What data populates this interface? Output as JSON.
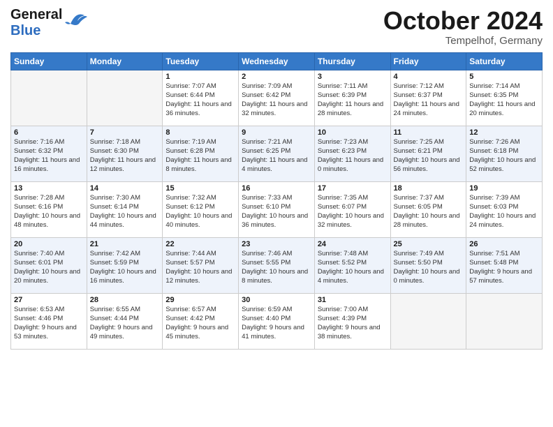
{
  "header": {
    "logo_general": "General",
    "logo_blue": "Blue",
    "title": "October 2024",
    "location": "Tempelhof, Germany"
  },
  "days_of_week": [
    "Sunday",
    "Monday",
    "Tuesday",
    "Wednesday",
    "Thursday",
    "Friday",
    "Saturday"
  ],
  "weeks": [
    [
      {
        "num": "",
        "info": ""
      },
      {
        "num": "",
        "info": ""
      },
      {
        "num": "1",
        "info": "Sunrise: 7:07 AM\nSunset: 6:44 PM\nDaylight: 11 hours and 36 minutes."
      },
      {
        "num": "2",
        "info": "Sunrise: 7:09 AM\nSunset: 6:42 PM\nDaylight: 11 hours and 32 minutes."
      },
      {
        "num": "3",
        "info": "Sunrise: 7:11 AM\nSunset: 6:39 PM\nDaylight: 11 hours and 28 minutes."
      },
      {
        "num": "4",
        "info": "Sunrise: 7:12 AM\nSunset: 6:37 PM\nDaylight: 11 hours and 24 minutes."
      },
      {
        "num": "5",
        "info": "Sunrise: 7:14 AM\nSunset: 6:35 PM\nDaylight: 11 hours and 20 minutes."
      }
    ],
    [
      {
        "num": "6",
        "info": "Sunrise: 7:16 AM\nSunset: 6:32 PM\nDaylight: 11 hours and 16 minutes."
      },
      {
        "num": "7",
        "info": "Sunrise: 7:18 AM\nSunset: 6:30 PM\nDaylight: 11 hours and 12 minutes."
      },
      {
        "num": "8",
        "info": "Sunrise: 7:19 AM\nSunset: 6:28 PM\nDaylight: 11 hours and 8 minutes."
      },
      {
        "num": "9",
        "info": "Sunrise: 7:21 AM\nSunset: 6:25 PM\nDaylight: 11 hours and 4 minutes."
      },
      {
        "num": "10",
        "info": "Sunrise: 7:23 AM\nSunset: 6:23 PM\nDaylight: 11 hours and 0 minutes."
      },
      {
        "num": "11",
        "info": "Sunrise: 7:25 AM\nSunset: 6:21 PM\nDaylight: 10 hours and 56 minutes."
      },
      {
        "num": "12",
        "info": "Sunrise: 7:26 AM\nSunset: 6:18 PM\nDaylight: 10 hours and 52 minutes."
      }
    ],
    [
      {
        "num": "13",
        "info": "Sunrise: 7:28 AM\nSunset: 6:16 PM\nDaylight: 10 hours and 48 minutes."
      },
      {
        "num": "14",
        "info": "Sunrise: 7:30 AM\nSunset: 6:14 PM\nDaylight: 10 hours and 44 minutes."
      },
      {
        "num": "15",
        "info": "Sunrise: 7:32 AM\nSunset: 6:12 PM\nDaylight: 10 hours and 40 minutes."
      },
      {
        "num": "16",
        "info": "Sunrise: 7:33 AM\nSunset: 6:10 PM\nDaylight: 10 hours and 36 minutes."
      },
      {
        "num": "17",
        "info": "Sunrise: 7:35 AM\nSunset: 6:07 PM\nDaylight: 10 hours and 32 minutes."
      },
      {
        "num": "18",
        "info": "Sunrise: 7:37 AM\nSunset: 6:05 PM\nDaylight: 10 hours and 28 minutes."
      },
      {
        "num": "19",
        "info": "Sunrise: 7:39 AM\nSunset: 6:03 PM\nDaylight: 10 hours and 24 minutes."
      }
    ],
    [
      {
        "num": "20",
        "info": "Sunrise: 7:40 AM\nSunset: 6:01 PM\nDaylight: 10 hours and 20 minutes."
      },
      {
        "num": "21",
        "info": "Sunrise: 7:42 AM\nSunset: 5:59 PM\nDaylight: 10 hours and 16 minutes."
      },
      {
        "num": "22",
        "info": "Sunrise: 7:44 AM\nSunset: 5:57 PM\nDaylight: 10 hours and 12 minutes."
      },
      {
        "num": "23",
        "info": "Sunrise: 7:46 AM\nSunset: 5:55 PM\nDaylight: 10 hours and 8 minutes."
      },
      {
        "num": "24",
        "info": "Sunrise: 7:48 AM\nSunset: 5:52 PM\nDaylight: 10 hours and 4 minutes."
      },
      {
        "num": "25",
        "info": "Sunrise: 7:49 AM\nSunset: 5:50 PM\nDaylight: 10 hours and 0 minutes."
      },
      {
        "num": "26",
        "info": "Sunrise: 7:51 AM\nSunset: 5:48 PM\nDaylight: 9 hours and 57 minutes."
      }
    ],
    [
      {
        "num": "27",
        "info": "Sunrise: 6:53 AM\nSunset: 4:46 PM\nDaylight: 9 hours and 53 minutes."
      },
      {
        "num": "28",
        "info": "Sunrise: 6:55 AM\nSunset: 4:44 PM\nDaylight: 9 hours and 49 minutes."
      },
      {
        "num": "29",
        "info": "Sunrise: 6:57 AM\nSunset: 4:42 PM\nDaylight: 9 hours and 45 minutes."
      },
      {
        "num": "30",
        "info": "Sunrise: 6:59 AM\nSunset: 4:40 PM\nDaylight: 9 hours and 41 minutes."
      },
      {
        "num": "31",
        "info": "Sunrise: 7:00 AM\nSunset: 4:39 PM\nDaylight: 9 hours and 38 minutes."
      },
      {
        "num": "",
        "info": ""
      },
      {
        "num": "",
        "info": ""
      }
    ]
  ]
}
